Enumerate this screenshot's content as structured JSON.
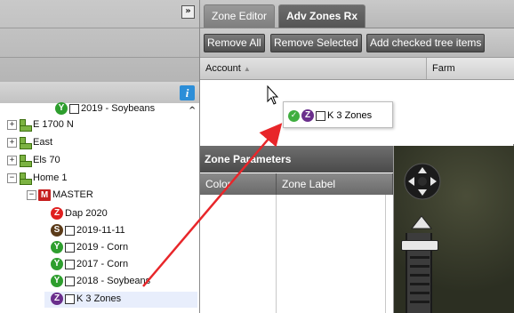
{
  "tabs": [
    {
      "label": "Zone Editor"
    },
    {
      "label": "Adv Zones Rx"
    }
  ],
  "toolbar": {
    "remove_all": "Remove All",
    "remove_selected": "Remove Selected",
    "add_checked": "Add checked tree items"
  },
  "grid": {
    "columns": [
      "Account",
      "Farm"
    ],
    "sort_indicator": "▲"
  },
  "drag_item": {
    "badge": "Z",
    "label": "K 3 Zones"
  },
  "zone_parameters": {
    "title": "Zone Parameters",
    "columns": [
      "Color",
      "Zone Label"
    ]
  },
  "tree": {
    "partial_item": "2019 - Soybeans",
    "farms": [
      "E 1700 N",
      "East",
      "Els 70",
      "Home 1"
    ],
    "master": {
      "badge": "M",
      "label": "MASTER"
    },
    "items": [
      {
        "badge": "Z",
        "label": "Dap 2020",
        "checkbox": false
      },
      {
        "badge": "S",
        "label": "2019-11-11",
        "checkbox": true
      },
      {
        "badge": "Y",
        "label": "2019 - Corn",
        "checkbox": true
      },
      {
        "badge": "Y",
        "label": "2017 - Corn",
        "checkbox": true
      },
      {
        "badge": "Y",
        "label": "2018 - Soybeans",
        "checkbox": true
      },
      {
        "badge": "Z",
        "label": "K 3 Zones",
        "checkbox": true
      }
    ]
  },
  "icons": {
    "collapse": "collapse-double-chevron-icon",
    "info": "info-icon",
    "annotation": "red-arrow"
  },
  "colors": {
    "annotation_arrow": "#e8262a",
    "harvest_badge": "#2e9e2e",
    "zone_badge": "#e02020",
    "soil_badge": "#5b3b19",
    "selected_zone_badge": "#6a2e8c"
  }
}
